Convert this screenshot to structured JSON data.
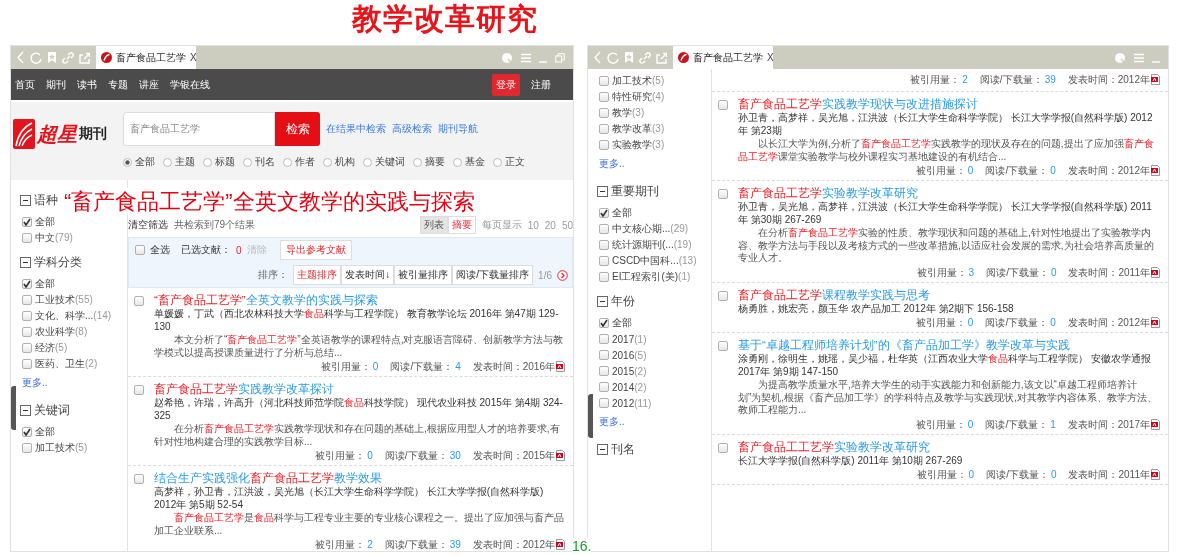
{
  "slide_title": "教学改革研究",
  "overlay_title": "“畜产食品工艺学”全英文教学的实践与探索",
  "page_number": "16.",
  "screens": [
    {
      "browser_tab": {
        "title": "畜产食品工艺学",
        "close": "X"
      },
      "nav": {
        "items": [
          "首页",
          "期刊",
          "读书",
          "专题",
          "讲座",
          "学银在线"
        ],
        "login": "登录",
        "register": "注册"
      },
      "header": {
        "logo_text": "超星",
        "logo_sub": "期刊",
        "search_value": "畜产食品工艺学",
        "search_button": "检索",
        "links": [
          "在结果中检索",
          "高级检索",
          "期刊导航"
        ],
        "scopes": [
          {
            "label": "全部",
            "selected": true
          },
          {
            "label": "主题",
            "selected": false
          },
          {
            "label": "标题",
            "selected": false
          },
          {
            "label": "刊名",
            "selected": false
          },
          {
            "label": "作者",
            "selected": false
          },
          {
            "label": "机构",
            "selected": false
          },
          {
            "label": "关键词",
            "selected": false
          },
          {
            "label": "摘要",
            "selected": false
          },
          {
            "label": "基金",
            "selected": false
          },
          {
            "label": "正文",
            "selected": false
          }
        ]
      },
      "sidebar": [
        {
          "heading": "语种",
          "items": [
            {
              "label": "全部",
              "checked": true
            },
            {
              "label": "中文",
              "count": "(79)",
              "checked": false
            }
          ]
        },
        {
          "heading": "学科分类",
          "items": [
            {
              "label": "全部",
              "checked": true
            },
            {
              "label": "工业技术",
              "count": "(55)",
              "checked": false
            },
            {
              "label": "文化、科学...",
              "count": "(14)",
              "checked": false
            },
            {
              "label": "农业科学",
              "count": "(8)",
              "checked": false
            },
            {
              "label": "经济",
              "count": "(5)",
              "checked": false
            },
            {
              "label": "医药、卫生",
              "count": "(2)",
              "checked": false
            }
          ],
          "more": "更多.."
        },
        {
          "heading": "关键词",
          "items": [
            {
              "label": "全部",
              "checked": true
            },
            {
              "label": "加工技术",
              "count": "(5)",
              "checked": false
            }
          ]
        }
      ],
      "result_head": {
        "clear_filters": "清空筛选",
        "count": "共检索到79个结果",
        "views": [
          {
            "label": "列表",
            "selected": false
          },
          {
            "label": "摘要",
            "selected": true
          }
        ],
        "per_page_label": "每页显示",
        "per_page": [
          "10",
          "20",
          "50"
        ]
      },
      "toolbar": {
        "select_all": "全选",
        "checked": false,
        "selected_label": "已选文献：",
        "selected_count": "0",
        "clear": "清除",
        "export": "导出参考文献",
        "sort_label": "排序：",
        "sorts": [
          {
            "label": "主题排序",
            "selected": true
          },
          {
            "label": "发表时间↓",
            "selected": false
          },
          {
            "label": "被引量排序",
            "selected": false
          },
          {
            "label": "阅读/下载量排序",
            "selected": false
          }
        ],
        "page": "1/6"
      },
      "results": [
        {
          "checked": false,
          "title": [
            {
              "text": "“畜产食品工艺学”",
              "highlight": true
            },
            {
              "text": "全英文教学的实践与探索",
              "highlight": false
            }
          ],
          "authors": [
            {
              "text": "单媛媛，丁武（西北农林科技大学",
              "highlight": false
            },
            {
              "text": "食品",
              "highlight": true
            },
            {
              "text": "科学与工程学院） 教育教学论坛  2016年 第47期 129-130",
              "highlight": false
            }
          ],
          "abstract": [
            {
              "text": "本文分析了“",
              "highlight": false
            },
            {
              "text": "畜产食品工艺学",
              "highlight": true
            },
            {
              "text": "”全英语教学的课程特点,对克服语言障碍、创新教学方法与教学模式以提高授课质量进行了分析与总结...",
              "highlight": false
            }
          ],
          "stats": [
            {
              "label": "被引用量：",
              "value": "0"
            },
            {
              "label": "阅读/下载量：",
              "value": "4"
            },
            {
              "label": "发表时间：",
              "value": "2016年"
            }
          ]
        },
        {
          "checked": false,
          "title": [
            {
              "text": "畜产食品工艺学",
              "highlight": true
            },
            {
              "text": "实践教学改革探讨",
              "highlight": false
            }
          ],
          "authors": [
            {
              "text": "赵希艳，许瑞，许高升（河北科技师范学院",
              "highlight": false
            },
            {
              "text": "食品",
              "highlight": true
            },
            {
              "text": "科技学院） 现代农业科技  2015年 第4期 324-325",
              "highlight": false
            }
          ],
          "abstract": [
            {
              "text": "在分析",
              "highlight": false
            },
            {
              "text": "畜产食品工艺学",
              "highlight": true
            },
            {
              "text": "实践教学现状和存在问题的基础上,根据应用型人才的培养要求,有针对性地构建合理的实践教学目标...",
              "highlight": false
            }
          ],
          "stats": [
            {
              "label": "被引用量：",
              "value": "0"
            },
            {
              "label": "阅读/下载量：",
              "value": "30"
            },
            {
              "label": "发表时间：",
              "value": "2015年"
            }
          ]
        },
        {
          "checked": false,
          "title": [
            {
              "text": "结合生产实践强化",
              "highlight": false
            },
            {
              "text": "畜产食品工艺学",
              "highlight": true
            },
            {
              "text": "教学效果",
              "highlight": false
            }
          ],
          "authors": [
            {
              "text": "高梦祥，孙卫青，江洪波，吴光旭（长江大学生命科学学院） 长江大学学报(自然科学版)  2012年 第5期 52-54",
              "highlight": false
            }
          ],
          "abstract": [
            {
              "text": "畜产食品工艺学",
              "highlight": true
            },
            {
              "text": "是",
              "highlight": false
            },
            {
              "text": "食品",
              "highlight": true
            },
            {
              "text": "科学与工程专业主要的专业核心课程之一。提出了应加强与畜产品加工企业联系...",
              "highlight": false
            }
          ],
          "stats": [
            {
              "label": "被引用量：",
              "value": "2"
            },
            {
              "label": "阅读/下载量：",
              "value": "39"
            },
            {
              "label": "发表时间：",
              "value": "2012年"
            }
          ]
        }
      ]
    },
    {
      "browser_tab": {
        "title": "畜产食品工艺学",
        "close": "X"
      },
      "sidebar": [
        {
          "items": [
            {
              "label": "加工技术",
              "count": "(5)",
              "checked": false
            },
            {
              "label": "特性研究",
              "count": "(4)",
              "checked": false
            },
            {
              "label": "教学",
              "count": "(3)",
              "checked": false
            },
            {
              "label": "教学改革",
              "count": "(3)",
              "checked": false
            },
            {
              "label": "实验教学",
              "count": "(3)",
              "checked": false
            }
          ],
          "more": "更多.."
        },
        {
          "heading": "重要期刊",
          "items": [
            {
              "label": "全部",
              "checked": true
            },
            {
              "label": "中文核心期...",
              "count": "(29)",
              "checked": false
            },
            {
              "label": "统计源期刊(...",
              "count": "(19)",
              "checked": false
            },
            {
              "label": "CSCD中国科...",
              "count": "(13)",
              "checked": false
            },
            {
              "label": "EI工程索引(美)",
              "count": "(1)",
              "checked": false
            }
          ]
        },
        {
          "heading": "年份",
          "items": [
            {
              "label": "全部",
              "checked": true
            },
            {
              "label": "2017",
              "count": "(1)",
              "checked": false
            },
            {
              "label": "2016",
              "count": "(5)",
              "checked": false
            },
            {
              "label": "2015",
              "count": "(2)",
              "checked": false
            },
            {
              "label": "2014",
              "count": "(2)",
              "checked": false
            },
            {
              "label": "2012",
              "count": "(11)",
              "checked": false
            }
          ],
          "more": "更多.."
        },
        {
          "heading": "刊名"
        }
      ],
      "lead_stats": [
        {
          "label": "被引用量：",
          "value": "2"
        },
        {
          "label": "阅读/下载量：",
          "value": "39"
        },
        {
          "label": "发表时间：",
          "value": "2012年"
        }
      ],
      "results": [
        {
          "checked": false,
          "title": [
            {
              "text": "畜产食品工艺学",
              "highlight": true
            },
            {
              "text": "实践教学现状与改进措施探讨",
              "highlight": false
            }
          ],
          "authors": [
            {
              "text": "孙卫青，高梦祥，吴光旭，江洪波（长江大学生命科学学院） 长江大学学报(自然科学版)  2012年 第23期",
              "highlight": false
            }
          ],
          "abstract": [
            {
              "text": "以长江大学为例,分析了",
              "highlight": false
            },
            {
              "text": "畜产食品工艺学",
              "highlight": true
            },
            {
              "text": "实践教学的现状及存在的问题,提出了应加强",
              "highlight": false
            },
            {
              "text": "畜产食品工艺学",
              "highlight": true
            },
            {
              "text": "课堂实验教学与校外课程实习基地建设的有机结合...",
              "highlight": false
            }
          ],
          "stats": [
            {
              "label": "被引用量：",
              "value": "0"
            },
            {
              "label": "阅读/下载量：",
              "value": "0"
            },
            {
              "label": "发表时间：",
              "value": "2012年"
            }
          ]
        },
        {
          "checked": false,
          "title": [
            {
              "text": "畜产食品工艺学",
              "highlight": true
            },
            {
              "text": "实验教学改革研究",
              "highlight": false
            }
          ],
          "authors": [
            {
              "text": "孙卫青，吴光旭，高梦祥，江洪波（长江大学生命科学学院） 长江大学学报(自然科学版)  2011年 第30期 267-269",
              "highlight": false
            }
          ],
          "abstract": [
            {
              "text": "在分析",
              "highlight": false
            },
            {
              "text": "畜产食品工艺学",
              "highlight": true
            },
            {
              "text": "实验的性质、教学现状和问题的基础上,针对性地提出了实验教学内容、教学方法与手段以及考核方式的一些改革措施,以适应社会发展的需求,为社会培养高质量的专业人才。",
              "highlight": false
            }
          ],
          "stats": [
            {
              "label": "被引用量：",
              "value": "3"
            },
            {
              "label": "阅读/下载量：",
              "value": "0"
            },
            {
              "label": "发表时间：",
              "value": "2011年"
            }
          ]
        },
        {
          "checked": false,
          "title": [
            {
              "text": "畜产食品工艺学",
              "highlight": true
            },
            {
              "text": "课程教学实践与思考",
              "highlight": false
            }
          ],
          "authors": [
            {
              "text": "杨勇胜，姚宏亮，颜玉华 农产品加工  2012年 第2期下 156-158",
              "highlight": false
            }
          ],
          "stats": [
            {
              "label": "被引用量：",
              "value": "0"
            },
            {
              "label": "阅读/下载量：",
              "value": "0"
            },
            {
              "label": "发表时间：",
              "value": "2012年"
            }
          ]
        },
        {
          "checked": false,
          "title": [
            {
              "text": "基于“卓越工程师培养计划”的《畜产品加工学》教学改革与实践",
              "highlight": false
            }
          ],
          "authors": [
            {
              "text": "涂勇刚，徐明生，姚瑶，吴少福，杜华英（江西农业大学",
              "highlight": false
            },
            {
              "text": "食品",
              "highlight": true
            },
            {
              "text": "科学与工程学院） 安徽农学通报  2017年 第9期 147-150",
              "highlight": false
            }
          ],
          "abstract": [
            {
              "text": "为提高教学质量水平,培养大学生的动手实践能力和创新能力,该文以“卓越工程师培养计划”为契机,根据《畜产品加工学》的学科特点及教学与实践现状,对其教学内容体系、教学方法、教师工程能力...",
              "highlight": false
            }
          ],
          "stats": [
            {
              "label": "被引用量：",
              "value": "0"
            },
            {
              "label": "阅读/下载量：",
              "value": "1"
            },
            {
              "label": "发表时间：",
              "value": "2017年"
            }
          ]
        },
        {
          "checked": false,
          "title": [
            {
              "text": "畜产食品工工艺学",
              "highlight": true
            },
            {
              "text": "实验教学改革研究",
              "highlight": false
            }
          ],
          "authors": [
            {
              "text": "长江大学学报(自然科学版)  2011年 第10期 267-269",
              "highlight": false
            }
          ],
          "stats": [
            {
              "label": "被引用量：",
              "value": "0"
            },
            {
              "label": "阅读/下载量：",
              "value": "0"
            },
            {
              "label": "发表时间：",
              "value": "2011年"
            }
          ]
        }
      ]
    }
  ]
}
